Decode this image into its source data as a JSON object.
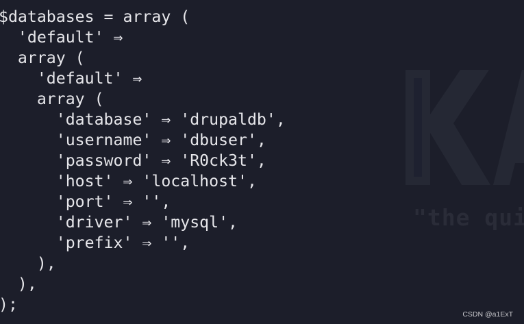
{
  "terminal": {
    "code_lines": [
      "$databases = array (",
      "  'default' ⇒",
      "  array (",
      "    'default' ⇒",
      "    array (",
      "      'database' ⇒ 'drupaldb',",
      "      'username' ⇒ 'dbuser',",
      "      'password' ⇒ 'R0ck3t',",
      "      'host' ⇒ 'localhost',",
      "      'port' ⇒ '',",
      "      'driver' ⇒ 'mysql',",
      "      'prefix' ⇒ '',",
      "    ),",
      "  ),",
      ");"
    ],
    "background_color": "#1c1e2a",
    "text_color": "#e6e6ea"
  },
  "wallpaper": {
    "logo_text": "KA",
    "tagline": "\"the qui",
    "logo_color": "#252834"
  },
  "watermark": {
    "text": "CSDN @a1ExT"
  }
}
